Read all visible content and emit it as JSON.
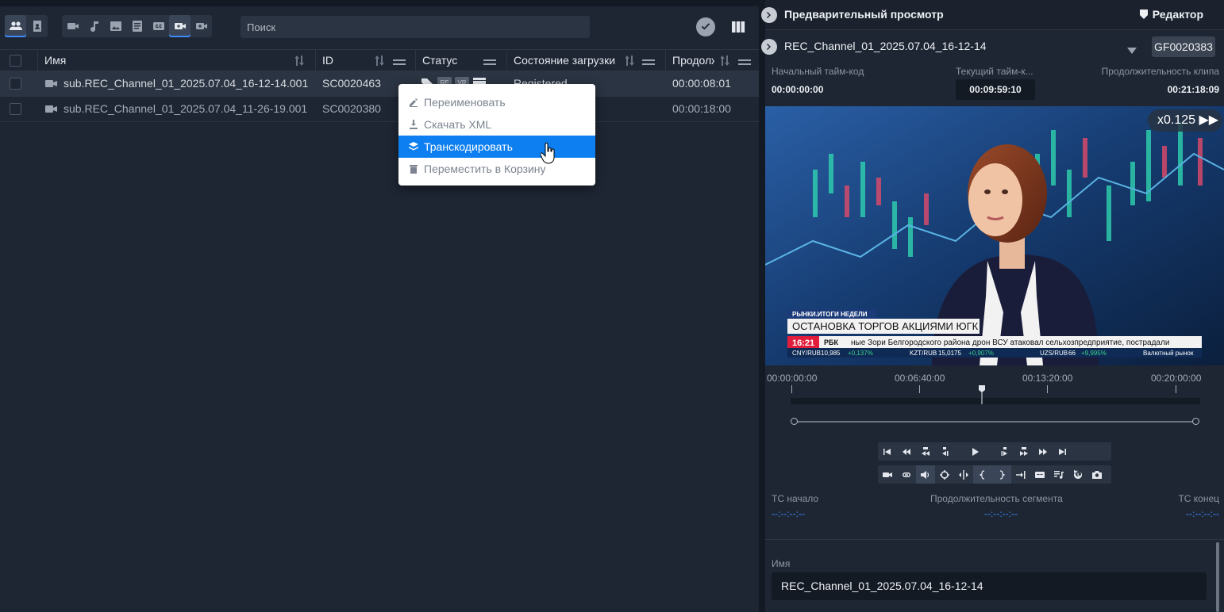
{
  "left": {
    "search": {
      "placeholder": "Поиск"
    },
    "columns": {
      "name": "Имя",
      "id": "ID",
      "status": "Статус",
      "upload_state": "Состояние загрузки",
      "duration": "Продолжительность"
    },
    "rows": [
      {
        "name": "sub.REC_Channel_01_2025.07.04_16-12-14.001",
        "id": "SC0020463",
        "status_text": "Registered",
        "duration": "00:00:08:01"
      },
      {
        "name": "sub.REC_Channel_01_2025.07.04_11-26-19.001",
        "id": "SC0020380",
        "status_text": "",
        "duration": "00:00:18:00"
      }
    ],
    "status_badges": [
      "RE",
      "VR"
    ],
    "context_menu": [
      {
        "label": "Переименовать",
        "icon": "pencil-icon"
      },
      {
        "label": "Скачать XML",
        "icon": "download-icon"
      },
      {
        "label": "Транскодировать",
        "icon": "layers-icon"
      },
      {
        "label": "Переместить в Корзину",
        "icon": "trash-icon"
      }
    ]
  },
  "right": {
    "title": "Предварительный просмотр",
    "editor_label": "Редактор",
    "clip_name": "REC_Channel_01_2025.07.04_16-12-14",
    "clip_id": "GF0020383",
    "timecodes": {
      "start_label": "Начальный тайм-код",
      "start_value": "00:00:00:00",
      "current_label": "Текущий тайм-к...",
      "current_value": "00:09:59:10",
      "duration_label": "Продолжительность клипа",
      "duration_value": "00:21:18:09"
    },
    "playback_speed": "x0.125 ▶▶",
    "video": {
      "lower_third_tag": "РЫНКИ.ИТОГИ НЕДЕЛИ",
      "headline": "ОСТАНОВКА ТОРГОВ АКЦИЯМИ ЮГК",
      "clock": "16:21",
      "channel": "РБК",
      "ticker": "ные Зори Белгородского района дрон ВСУ атаковал сельхозпредприятие, пострадали",
      "rates": [
        {
          "pair": "CNY/RUB",
          "value": "10,985",
          "change": "+0,137%"
        },
        {
          "pair": "KZT/RUB",
          "value": "15,0175",
          "change": "+0,907%"
        },
        {
          "pair": "UZS/RUB",
          "value": "66",
          "change": "+9,995%"
        }
      ],
      "market_label": "Валютный рынок"
    },
    "ruler": [
      "00:00:00:00",
      "00:06:40:00",
      "00:13:20:00",
      "00:20:00:00"
    ],
    "playhead_fraction": 0.469,
    "segment": {
      "tc_start_label": "TC начало",
      "tc_start_value": "--:--:--:--",
      "duration_label": "Продолжительность сегмента",
      "duration_value": "--:--:--:--",
      "tc_end_label": "TC конец",
      "tc_end_value": "--:--:--:--"
    },
    "name_label": "Имя",
    "name_value": "REC_Channel_01_2025.07.04_16-12-14"
  },
  "colors": {
    "accent": "#0d7ff0",
    "bg": "#1e2634",
    "panel": "#2b3442"
  }
}
